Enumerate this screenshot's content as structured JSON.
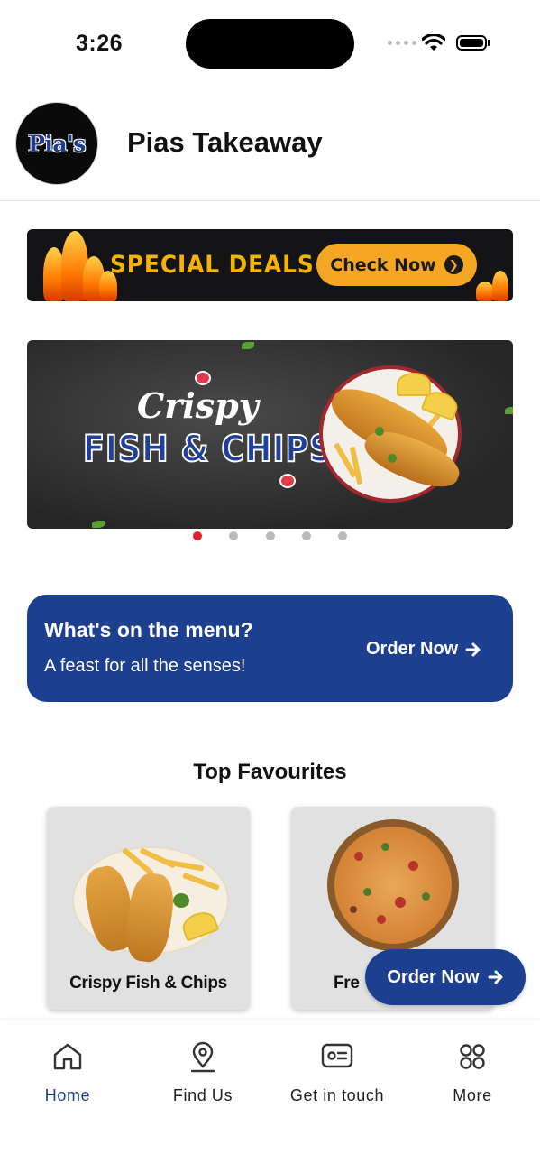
{
  "status_bar": {
    "time": "3:26"
  },
  "header": {
    "logo_text": "Pia's",
    "title": "Pias Takeaway"
  },
  "promo_banner": {
    "text": "SPECIAL DEALS",
    "button_label": "Check Now"
  },
  "carousel": {
    "slide_title_1": "Crispy",
    "slide_title_2": "FISH & CHIPS",
    "slide_count": 5,
    "active_index": 0
  },
  "menu_card": {
    "title": "What's on the menu?",
    "subtitle": "A feast for all the senses!",
    "cta_label": "Order Now"
  },
  "favourites": {
    "heading": "Top Favourites",
    "items": [
      {
        "name": "Crispy Fish & Chips"
      },
      {
        "name": "Fre"
      }
    ]
  },
  "floating_button": {
    "label": "Order Now"
  },
  "tab_bar": {
    "items": [
      {
        "label": "Home",
        "icon": "home-icon",
        "active": true
      },
      {
        "label": "Find Us",
        "icon": "location-pin-icon",
        "active": false
      },
      {
        "label": "Get in touch",
        "icon": "contact-card-icon",
        "active": false
      },
      {
        "label": "More",
        "icon": "grid-icon",
        "active": false
      }
    ]
  },
  "colors": {
    "brand_blue": "#1c3f8f",
    "promo_orange": "#f5a623",
    "carousel_active_dot": "#e01f2a",
    "carousel_inactive_dot": "#bbbbbb"
  }
}
